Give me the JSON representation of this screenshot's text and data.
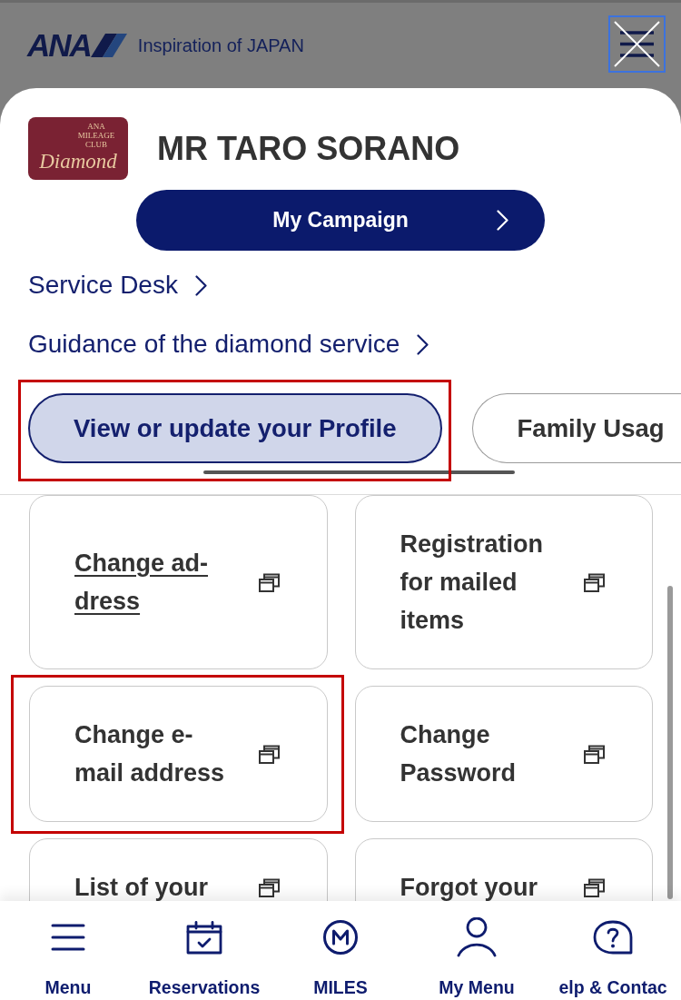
{
  "header": {
    "logo": "ANA",
    "tagline": "Inspiration of JAPAN"
  },
  "member": {
    "card": {
      "club": "ANA MILEAGE CLUB",
      "tier": "Diamond"
    },
    "name": "MR TARO SORANO"
  },
  "campaign_button": {
    "label": "My Campaign"
  },
  "links": [
    {
      "label": "Service Desk"
    },
    {
      "label": "Guidance of the diamond service"
    }
  ],
  "tabs": [
    {
      "label": "View or update your Profile",
      "selected": true,
      "highlighted": true
    },
    {
      "label": "Family Usag",
      "selected": false,
      "highlighted": false
    }
  ],
  "tile_rows": [
    [
      {
        "label": "Change ad-\ndress",
        "hovered": true,
        "highlighted": false
      },
      {
        "label": "Registration\nfor mailed\nitems",
        "hovered": false,
        "highlighted": false
      }
    ],
    [
      {
        "label": "Change e-\nmail address",
        "hovered": false,
        "highlighted": true
      },
      {
        "label": "Change\nPassword",
        "hovered": false,
        "highlighted": false
      }
    ],
    [
      {
        "label": "List of your",
        "hovered": false,
        "highlighted": false
      },
      {
        "label": "Forgot your",
        "hovered": false,
        "highlighted": false
      }
    ]
  ],
  "bottom_nav": [
    {
      "label": "Menu",
      "kind": "menu"
    },
    {
      "label": "Reservations",
      "kind": "calendar"
    },
    {
      "label": "MILES",
      "kind": "miles"
    },
    {
      "label": "My Menu",
      "kind": "person"
    },
    {
      "label": "elp & Contac",
      "kind": "help"
    }
  ]
}
